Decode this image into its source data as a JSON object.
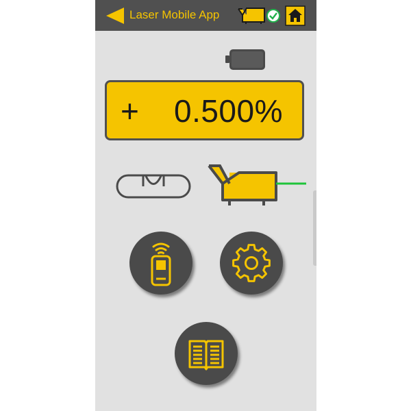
{
  "header": {
    "title": "Laser Mobile App",
    "back_icon": "back-arrow-icon",
    "status_icon": "laser-connected-icon",
    "home_icon": "home-icon"
  },
  "status": {
    "battery_icon": "battery-icon"
  },
  "display": {
    "sign": "+",
    "grade": "0.500%"
  },
  "indicators": {
    "level_icon": "bubble-level-icon",
    "laser_icon": "laser-device-icon"
  },
  "actions": [
    {
      "id": "remote",
      "icon": "remote-control-icon"
    },
    {
      "id": "settings",
      "icon": "gear-icon"
    },
    {
      "id": "manual",
      "icon": "book-icon"
    }
  ],
  "colors": {
    "accent": "#f5c400",
    "header_bg": "#505050",
    "page_bg": "#e1e1e1",
    "button_bg": "#4a4a4a",
    "beam": "#1fc43a",
    "connected": "#22b14c"
  }
}
